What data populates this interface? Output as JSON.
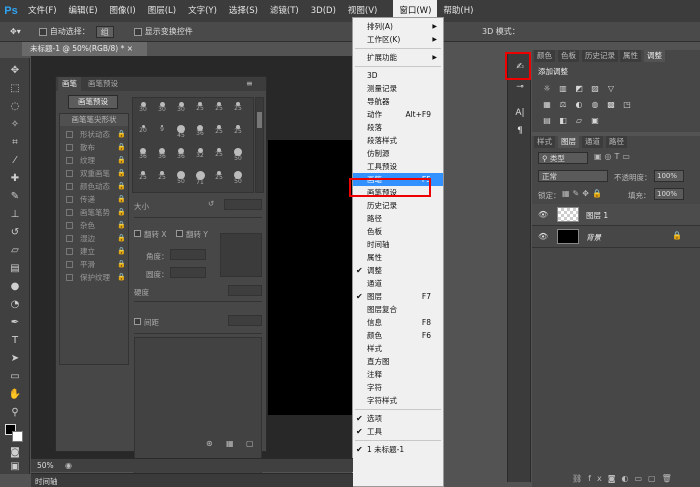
{
  "app": {
    "logo": "Ps"
  },
  "menubar": {
    "items": [
      "文件(F)",
      "编辑(E)",
      "图像(I)",
      "图层(L)",
      "文字(Y)",
      "选择(S)",
      "滤镜(T)",
      "3D(D)",
      "视图(V)",
      "窗口(W)",
      "帮助(H)"
    ],
    "active_index": 9
  },
  "optbar": {
    "auto_select_label": "自动选择：",
    "auto_select_value": "组",
    "show_transform_label": "显示变换控件",
    "mode_3d_label": "3D 模式："
  },
  "document": {
    "tab_title": "未标题-1 @ 50%(RGB/8) *"
  },
  "brush_panel": {
    "tabs": [
      "画笔",
      "画笔预设"
    ],
    "presets_button": "画笔预设",
    "list_header": "画笔笔尖形状",
    "options": [
      "形状动态",
      "散布",
      "纹理",
      "双重画笔",
      "颜色动态",
      "传递",
      "画笔笔势",
      "杂色",
      "湿边",
      "建立",
      "平滑",
      "保护纹理"
    ],
    "tip_sizes": [
      "30",
      "30",
      "30",
      "25",
      "25",
      "25",
      "20",
      "9",
      "45",
      "36",
      "25",
      "25",
      "36",
      "36",
      "36",
      "32",
      "25",
      "50",
      "25",
      "25",
      "50",
      "71",
      "25",
      "50"
    ],
    "size_label": "大小",
    "flip_x": "翻转 X",
    "flip_y": "翻转 Y",
    "angle_label": "角度：",
    "roundness_label": "圆度：",
    "hardness_label": "硬度",
    "spacing_label": "间距"
  },
  "window_menu": {
    "items": [
      {
        "label": "排列(A)",
        "submenu": true
      },
      {
        "label": "工作区(K)",
        "submenu": true
      },
      {
        "sep": true
      },
      {
        "label": "扩展功能",
        "submenu": true
      },
      {
        "sep": true
      },
      {
        "label": "3D"
      },
      {
        "label": "测量记录"
      },
      {
        "label": "导航器"
      },
      {
        "label": "动作",
        "shortcut": "Alt+F9"
      },
      {
        "label": "段落"
      },
      {
        "label": "段落样式"
      },
      {
        "label": "仿制源"
      },
      {
        "label": "工具预设"
      },
      {
        "label": "画笔",
        "shortcut": "F5",
        "highlight": true
      },
      {
        "label": "画笔预设"
      },
      {
        "label": "历史记录"
      },
      {
        "label": "路径"
      },
      {
        "label": "色板"
      },
      {
        "label": "时间轴"
      },
      {
        "label": "属性"
      },
      {
        "label": "调整",
        "checked": true
      },
      {
        "label": "通道"
      },
      {
        "label": "图层",
        "shortcut": "F7",
        "checked": true
      },
      {
        "label": "图层复合"
      },
      {
        "label": "信息",
        "shortcut": "F8"
      },
      {
        "label": "颜色",
        "shortcut": "F6"
      },
      {
        "label": "样式"
      },
      {
        "label": "直方图"
      },
      {
        "label": "注释"
      },
      {
        "label": "字符"
      },
      {
        "label": "字符样式"
      },
      {
        "sep": true
      },
      {
        "label": "选项",
        "checked": true
      },
      {
        "label": "工具",
        "checked": true
      },
      {
        "sep": true
      },
      {
        "label": "1 未标题-1",
        "checked": true
      }
    ]
  },
  "right_top_panel": {
    "tabs": [
      "颜色",
      "色板",
      "历史记录",
      "属性",
      "调整"
    ],
    "active_tab": 4,
    "title": "添加调整"
  },
  "layers_panel": {
    "tabs": [
      "样式",
      "图层",
      "通道",
      "路径"
    ],
    "active_tab": 1,
    "filter_label": "类型",
    "blend_mode": "正常",
    "opacity_label": "不透明度：",
    "opacity_value": "100%",
    "lock_label": "锁定：",
    "fill_label": "填充：",
    "fill_value": "100%",
    "layers": [
      {
        "name": "图层 1",
        "thumb": "transparent"
      },
      {
        "name": "背景",
        "thumb": "black",
        "locked": true
      }
    ]
  },
  "status": {
    "zoom": "50%"
  },
  "timeline": {
    "label": "时间轴"
  }
}
